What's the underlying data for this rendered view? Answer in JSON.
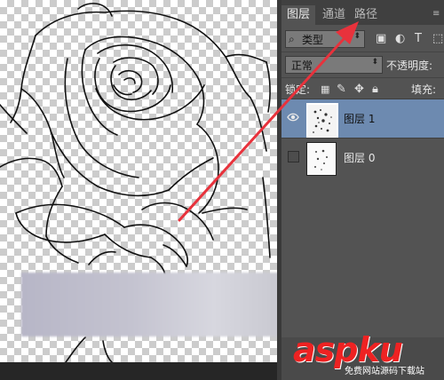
{
  "tabs": [
    "图层",
    "通道",
    "路径"
  ],
  "filter": {
    "label": "类型"
  },
  "blend_mode": "正常",
  "opacity_label": "不透明度:",
  "lock_label": "锁定:",
  "fill_label": "填充:",
  "layers": [
    {
      "name": "图层 1",
      "visible": true,
      "selected": true
    },
    {
      "name": "图层 0",
      "visible": false,
      "selected": false
    }
  ],
  "watermark": {
    "main": "aspku",
    "sub": "免费网站源码下载站"
  },
  "colors": {
    "panel": "#535353",
    "selected_layer": "#6d8ab0",
    "arrow": "#e8323c"
  }
}
